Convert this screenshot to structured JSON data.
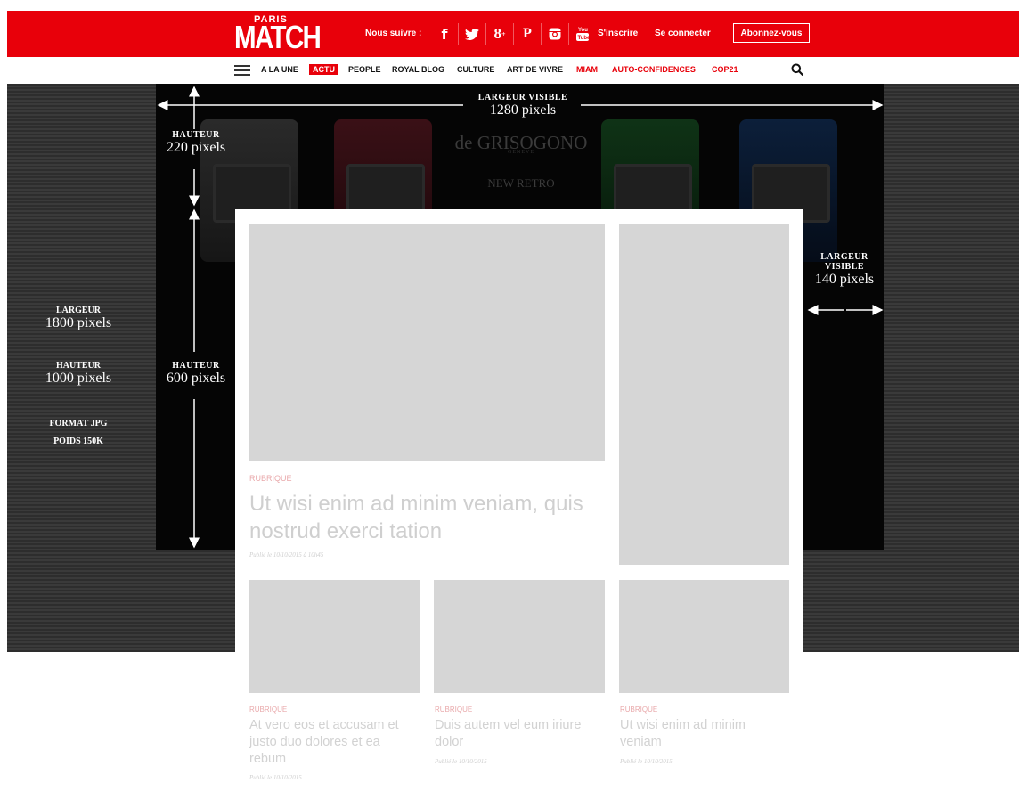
{
  "header": {
    "logo_top": "PARIS",
    "logo_main": "MATCH",
    "follow_label": "Nous suivre :",
    "social_icons": [
      "facebook-icon",
      "twitter-icon",
      "google-plus-icon",
      "pinterest-icon",
      "instagram-icon",
      "youtube-icon"
    ],
    "signup": "S'inscrire",
    "login": "Se connecter",
    "subscribe": "Abonnez-vous"
  },
  "nav": {
    "items": [
      "A LA UNE",
      "ACTU",
      "PEOPLE",
      "ROYAL BLOG",
      "CULTURE",
      "ART DE VIVRE",
      "MIAM",
      "AUTO-CONFIDENCES",
      "COP21"
    ],
    "active": "ACTU",
    "red_items": [
      "MIAM",
      "AUTO-CONFIDENCES",
      "COP21"
    ]
  },
  "ad": {
    "brand": "de GRISOGONO",
    "brand_sub": "GENEVE",
    "tagline": "NEW RETRO"
  },
  "annotations": {
    "largeur_visible_label": "LARGEUR VISIBLE",
    "largeur_visible_value": "1280 pixels",
    "hauteur_top_label": "HAUTEUR",
    "hauteur_top_value": "220 pixels",
    "largeur_side_label1": "LARGEUR",
    "largeur_side_label2": "VISIBLE",
    "largeur_side_value": "140 pixels",
    "hauteur_mid_label": "HAUTEUR",
    "hauteur_mid_value": "600 pixels",
    "left_largeur_label": "LARGEUR",
    "left_largeur_value": "1800 pixels",
    "left_hauteur_label": "HAUTEUR",
    "left_hauteur_value": "1000 pixels",
    "format": "FORMAT JPG",
    "poids": "POIDS 150K"
  },
  "articles": {
    "main": {
      "rubrique": "RUBRIQUE",
      "title": "Ut wisi enim ad minim veniam, quis nostrud exerci tation",
      "meta": "Publié le 10/10/2015 à 10h45"
    },
    "small": [
      {
        "rubrique": "RUBRIQUE",
        "title": "At vero eos et accusam et justo duo dolores et ea rebum",
        "meta": "Publié le 10/10/2015"
      },
      {
        "rubrique": "RUBRIQUE",
        "title": "Duis autem vel eum iriure dolor",
        "meta": "Publié le 10/10/2015"
      },
      {
        "rubrique": "RUBRIQUE",
        "title": "Ut wisi enim ad minim veniam",
        "meta": "Publié le 10/10/2015"
      }
    ]
  },
  "colors": {
    "brand_red": "#e8000a",
    "placeholder_gray": "#d6d6d6",
    "rubrique_pink": "#e9a9ab"
  }
}
